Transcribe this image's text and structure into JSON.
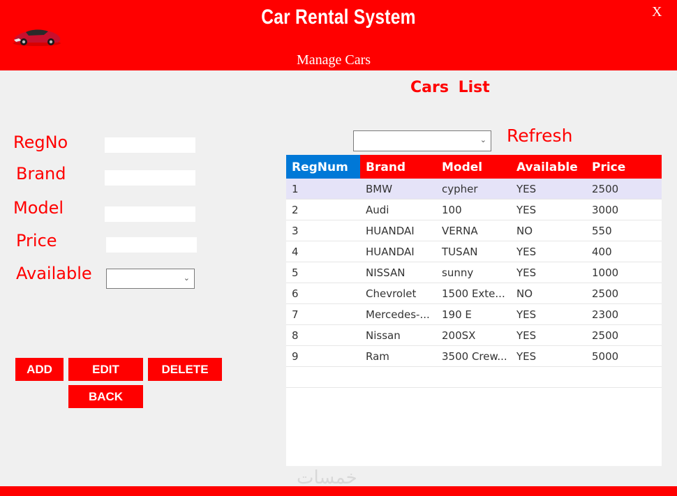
{
  "header": {
    "title": "Car Rental System",
    "subtitle": "Manage Cars",
    "close_label": "X",
    "logo_icon": "red-sports-car-icon"
  },
  "list_title": "Cars  List",
  "form": {
    "regno_label": "RegNo",
    "regno_value": "",
    "brand_label": "Brand",
    "brand_value": "",
    "model_label": "Model",
    "model_value": "",
    "price_label": "Price",
    "price_value": "",
    "available_label": "Available",
    "available_value": ""
  },
  "buttons": {
    "add": "ADD",
    "edit": "EDIT",
    "delete": "DELETE",
    "back": "BACK"
  },
  "filter": {
    "value": "",
    "refresh_label": "Refresh"
  },
  "table": {
    "columns": [
      "RegNum",
      "Brand",
      "Model",
      "Available",
      "Price"
    ],
    "rows": [
      [
        "1",
        "BMW",
        "cypher",
        "YES",
        "2500"
      ],
      [
        "2",
        "Audi",
        "100",
        "YES",
        "3000"
      ],
      [
        "3",
        "HUANDAI",
        "VERNA",
        "NO",
        "550"
      ],
      [
        "4",
        "HUANDAI",
        "TUSAN",
        "YES",
        "400"
      ],
      [
        "5",
        "NISSAN",
        "sunny",
        "YES",
        "1000"
      ],
      [
        "6",
        "Chevrolet",
        "1500 Exte...",
        "NO",
        "2500"
      ],
      [
        "7",
        "Mercedes-...",
        "190 E",
        "YES",
        "2300"
      ],
      [
        "8",
        "Nissan",
        "200SX",
        "YES",
        "2500"
      ],
      [
        "9",
        "Ram",
        "3500 Crew...",
        "YES",
        "5000"
      ]
    ]
  },
  "watermark": "خمسات",
  "colors": {
    "accent": "#ff0000",
    "selected_header": "#0078d7",
    "selected_row": "#e5e3f8"
  }
}
